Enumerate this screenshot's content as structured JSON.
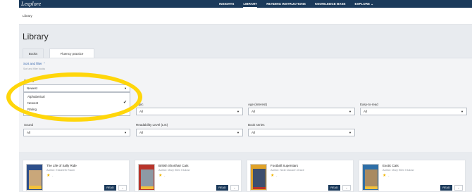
{
  "brand": "Lexplore",
  "nav": {
    "items": [
      {
        "label": "INSIGHTS"
      },
      {
        "label": "LIBRARY"
      },
      {
        "label": "READING INSTRUCTIONS"
      },
      {
        "label": "KNOWLEDGE BASE"
      },
      {
        "label": "EXPLORE ⌄"
      }
    ],
    "active_index": 1
  },
  "breadcrumb": "Library",
  "page_title": "Library",
  "tabs": [
    {
      "label": "Books"
    },
    {
      "label": "Fluency practice"
    }
  ],
  "sort_filter": {
    "label": "Sort and filter ⌃",
    "subtext": "Sort and filter books"
  },
  "sorting": {
    "label": "Sorting",
    "value": "Newest",
    "options": [
      "Alphabetical",
      "Newest",
      "Rating"
    ],
    "selected": "Newest"
  },
  "filters": [
    {
      "label": "Topic",
      "value": "All"
    },
    {
      "label": "Age (interest)",
      "value": "All"
    },
    {
      "label": "Easy-to-read",
      "value": "All"
    },
    {
      "label": "Sound",
      "value": "All"
    },
    {
      "label": "Readability Level (LIX)",
      "value": "All"
    },
    {
      "label": "Book series",
      "value": "All"
    }
  ],
  "books": [
    {
      "title": "The Life of Sally Ride",
      "author": "Author: Elizabeth Raum",
      "rating": "-",
      "read_label": "READ",
      "more_label": "⌄",
      "cover_color": "#2d4f8a"
    },
    {
      "title": "British Shorthair Cats",
      "author": "Author: Mary Ellen Klukow",
      "rating": "-",
      "read_label": "READ",
      "more_label": "⌄",
      "cover_color": "#b8342b"
    },
    {
      "title": "Football Superstars",
      "author": "Author: Nicki Clausen Grace",
      "rating": "-",
      "read_label": "READ",
      "more_label": "⌄",
      "cover_color": "#e0a32a"
    },
    {
      "title": "Exotic Cats",
      "author": "Author: Mary Ellen Klukow",
      "rating": "-",
      "read_label": "READ",
      "more_label": "⌄",
      "cover_color": "#2e6fa8"
    }
  ],
  "colors": {
    "nav_bg": "#1b3a5b",
    "highlight": "#ffd60a",
    "star": "#f0b400"
  }
}
